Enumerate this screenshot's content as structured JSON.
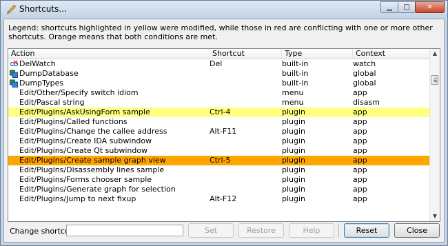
{
  "window": {
    "title": "Shortcuts...",
    "controls": {
      "minimize": "▁",
      "maximize": "□",
      "close": "✕"
    }
  },
  "legend": "Legend: shortcuts highlighted in yellow were modified, while those in red are conflicting with one or more other shortcuts. Orange means that both conditions are met.",
  "columns": {
    "action": "Action",
    "shortcut": "Shortcut",
    "type": "Type",
    "context": "Context"
  },
  "rows": [
    {
      "action": "DelWatch",
      "shortcut": "Del",
      "type": "built-in",
      "context": "watch",
      "icon": "delwatch-icon"
    },
    {
      "action": "DumpDatabase",
      "shortcut": "",
      "type": "built-in",
      "context": "global",
      "icon": "database-icon"
    },
    {
      "action": "DumpTypes",
      "shortcut": "",
      "type": "built-in",
      "context": "global",
      "icon": "database-icon"
    },
    {
      "action": "Edit/Other/Specify switch idiom",
      "shortcut": "",
      "type": "menu",
      "context": "app",
      "icon": ""
    },
    {
      "action": "Edit/Pascal string",
      "shortcut": "",
      "type": "menu",
      "context": "disasm",
      "icon": ""
    },
    {
      "action": "Edit/Plugins/AskUsingForm sample",
      "shortcut": "Ctrl-4",
      "type": "plugin",
      "context": "app",
      "icon": "",
      "highlight": "yellow"
    },
    {
      "action": "Edit/Plugins/Called functions",
      "shortcut": "",
      "type": "plugin",
      "context": "app",
      "icon": ""
    },
    {
      "action": "Edit/Plugins/Change the callee address",
      "shortcut": "Alt-F11",
      "type": "plugin",
      "context": "app",
      "icon": ""
    },
    {
      "action": "Edit/Plugins/Create IDA subwindow",
      "shortcut": "",
      "type": "plugin",
      "context": "app",
      "icon": ""
    },
    {
      "action": "Edit/Plugins/Create Qt subwindow",
      "shortcut": "",
      "type": "plugin",
      "context": "app",
      "icon": ""
    },
    {
      "action": "Edit/Plugins/Create sample graph view",
      "shortcut": "Ctrl-5",
      "type": "plugin",
      "context": "app",
      "icon": "",
      "highlight": "orange"
    },
    {
      "action": "Edit/Plugins/Disassembly lines sample",
      "shortcut": "",
      "type": "plugin",
      "context": "app",
      "icon": ""
    },
    {
      "action": "Edit/Plugins/Forms chooser sample",
      "shortcut": "",
      "type": "plugin",
      "context": "app",
      "icon": ""
    },
    {
      "action": "Edit/Plugins/Generate graph for selection",
      "shortcut": "",
      "type": "plugin",
      "context": "app",
      "icon": ""
    },
    {
      "action": "Edit/Plugins/Jump to next fixup",
      "shortcut": "Alt-F12",
      "type": "plugin",
      "context": "app",
      "icon": ""
    }
  ],
  "footer": {
    "change_label": "Change shortcut:",
    "input_value": "",
    "set_label": "Set",
    "restore_label": "Restore",
    "help_label": "Help",
    "reset_label": "Reset",
    "close_label": "Close"
  },
  "colors": {
    "modified": "#ffff80",
    "modified_and_conflicting": "#ffa500"
  }
}
